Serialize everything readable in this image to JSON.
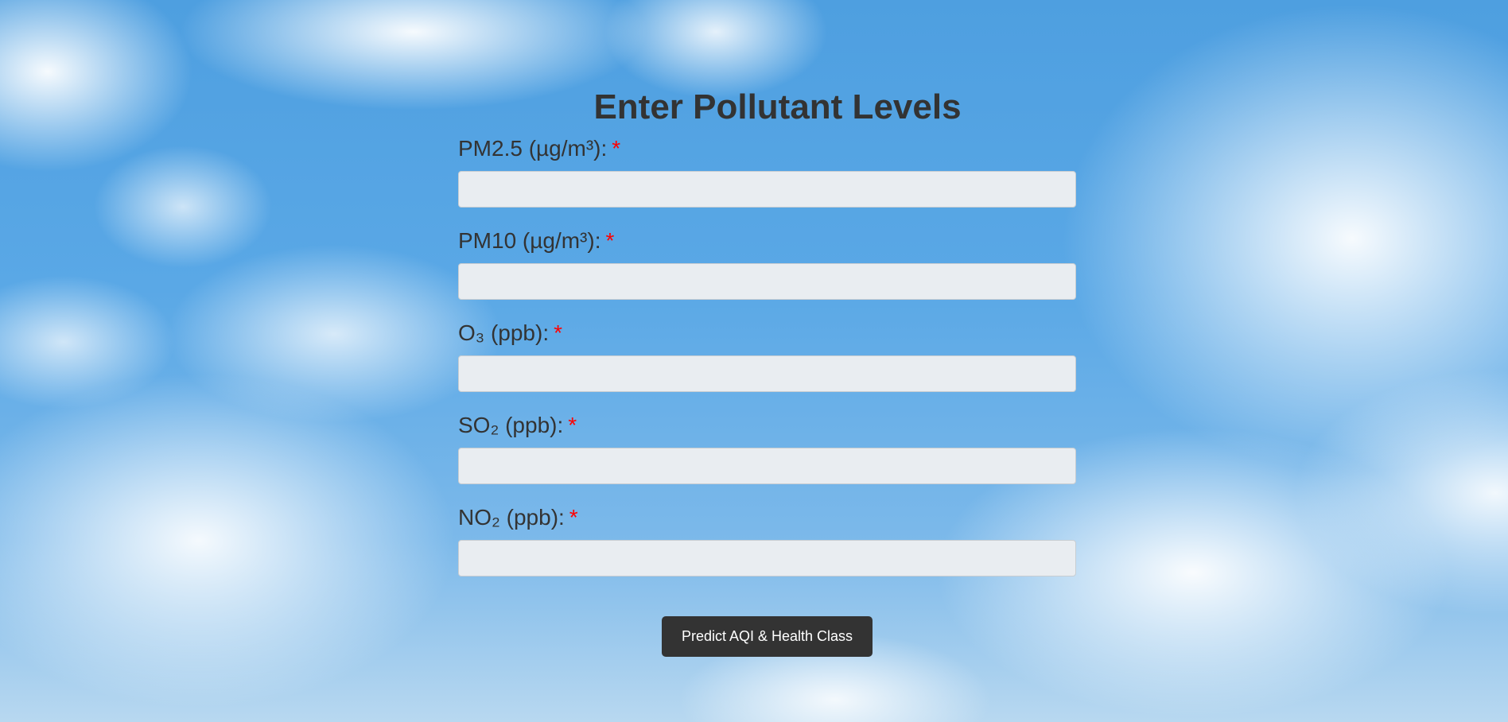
{
  "page": {
    "title": "Enter Pollutant Levels"
  },
  "form": {
    "fields": [
      {
        "label": "PM2.5 (µg/m³):",
        "required_mark": "*",
        "value": "",
        "placeholder": ""
      },
      {
        "label": "PM10 (µg/m³):",
        "required_mark": "*",
        "value": "",
        "placeholder": ""
      },
      {
        "label": "O₃ (ppb):",
        "required_mark": "*",
        "value": "",
        "placeholder": ""
      },
      {
        "label": "SO₂ (ppb):",
        "required_mark": "*",
        "value": "",
        "placeholder": ""
      },
      {
        "label": "NO₂ (ppb):",
        "required_mark": "*",
        "value": "",
        "placeholder": ""
      }
    ],
    "submit_label": "Predict AQI & Health Class"
  },
  "colors": {
    "text": "#333333",
    "required": "#ff0000",
    "input_bg": "#e9edf1",
    "button_bg": "#333333",
    "button_text": "#ffffff"
  }
}
